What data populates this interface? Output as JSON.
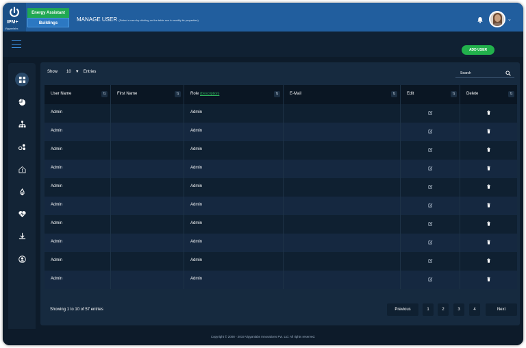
{
  "header": {
    "logo_text": "IPM+",
    "logo_tagline": "Vigyanlabs",
    "tab_energy": "Energy Assistant",
    "tab_buildings": "Buildings",
    "page_title": "MANAGE USER",
    "page_hint": "(Select a user by clicking on the table row to modify its properties)"
  },
  "toolbar": {
    "add_user_label": "ADD USER"
  },
  "controls": {
    "show_label": "Show",
    "entries_value": "10",
    "entries_label": "Entries",
    "search_label": "Search"
  },
  "table": {
    "columns": {
      "username": "User Name",
      "firstname": "First Name",
      "role": "Role",
      "role_desc": "(Description)",
      "email": "E-Mail",
      "edit": "Edit",
      "delete": "Delete"
    },
    "rows": [
      {
        "username": "Admin",
        "firstname": "",
        "role": "Admin",
        "email": ""
      },
      {
        "username": "Admin",
        "firstname": "",
        "role": "Admin",
        "email": ""
      },
      {
        "username": "Admin",
        "firstname": "",
        "role": "Admin",
        "email": ""
      },
      {
        "username": "Admin",
        "firstname": "",
        "role": "Admin",
        "email": ""
      },
      {
        "username": "Admin",
        "firstname": "",
        "role": "Admin",
        "email": ""
      },
      {
        "username": "Admin",
        "firstname": "",
        "role": "Admin",
        "email": ""
      },
      {
        "username": "Admin",
        "firstname": "",
        "role": "Admin",
        "email": ""
      },
      {
        "username": "Admin",
        "firstname": "",
        "role": "Admin",
        "email": ""
      },
      {
        "username": "Admin",
        "firstname": "",
        "role": "Admin",
        "email": ""
      },
      {
        "username": "Admin",
        "firstname": "",
        "role": "Admin",
        "email": ""
      }
    ]
  },
  "pagination": {
    "info": "Showing 1 to 10 of 57 entries",
    "previous": "Previous",
    "pages": [
      "1",
      "2",
      "3",
      "4"
    ],
    "next": "Next"
  },
  "sidebar": {
    "icons": [
      "dashboard-icon",
      "pie-chart-icon",
      "hierarchy-icon",
      "energy-devices-icon",
      "building-alert-icon",
      "recycle-icon",
      "health-icon",
      "download-icon",
      "user-account-icon"
    ]
  },
  "footer": {
    "copyright": "Copyright © 2008 - 2019 Vigyanlabs Innovations Pvt. Ltd. All rights reserved."
  },
  "colors": {
    "background": "#0d1b2a",
    "header": "#215e9e",
    "energy_tab": "#20a853",
    "add_user": "#22b14c",
    "accent_blue": "#3b8fe0"
  }
}
